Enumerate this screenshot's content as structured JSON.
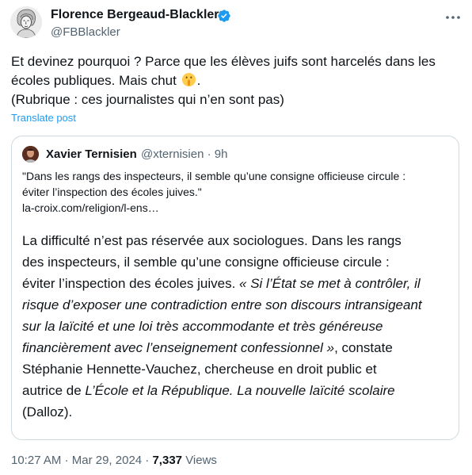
{
  "author": {
    "name": "Florence Bergeaud-Blackler",
    "handle": "@FBBlackler",
    "verified_color": "#1d9bf0"
  },
  "tweet": {
    "line1": "Et devinez pourquoi ? Parce que les élèves juifs sont harcelés dans les",
    "line2_text": "écoles publiques.  Mais chut ",
    "line2_emoji": "shushing-face-emoji",
    "line2_end": ".",
    "line3": "(Rubrique : ces journalistes qui n’en sont pas)",
    "translate_label": "Translate post"
  },
  "quoted": {
    "name": "Xavier Ternisien",
    "handle": "@xternisien",
    "separator": "·",
    "time": "9h",
    "text_line1": "\"Dans les rangs des inspecteurs, il semble qu’une consigne officieuse circule :",
    "text_line2": "éviter l’inspection des écoles juives.\"",
    "link": "la-croix.com/religion/l-ens…",
    "excerpt": {
      "s1": "La difficulté n’est pas réservée aux sociologues. Dans les rangs",
      "s2": "des inspecteurs, il semble qu’une consigne officieuse circule :",
      "s3_plain": "éviter l’inspection des écoles juives. ",
      "s3_italic": "« Si l’État se met à contrôler, il",
      "s4_italic": "risque d’exposer une contradiction entre son discours intransigeant",
      "s5_italic": "sur la laïcité et une loi très accommodante et très généreuse",
      "s6_italic": "financièrement avec l’enseignement confessionnel »",
      "s6_plain": ", constate",
      "s7": "Stéphanie Hennette-Vauchez, chercheuse en droit public et",
      "s8_plain": "autrice de ",
      "s8_italic": "L’École et la République. La nouvelle laïcité scolaire",
      "s9": "(Dalloz)."
    }
  },
  "footer": {
    "time": "10:27 AM",
    "dot": "·",
    "date": "Mar 29, 2024",
    "views_count": "7,337",
    "views_label": "Views"
  }
}
